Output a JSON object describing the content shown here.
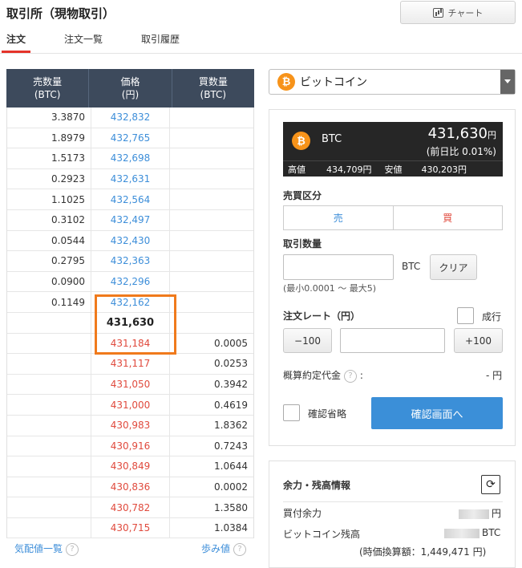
{
  "page_title": "取引所（現物取引）",
  "chart_button": {
    "label": "チャート",
    "icon": "chart-icon"
  },
  "tabs": [
    {
      "label": "注文",
      "active": true
    },
    {
      "label": "注文一覧",
      "active": false
    },
    {
      "label": "取引履歴",
      "active": false
    }
  ],
  "order_book": {
    "headers": [
      "売数量\n(BTC)",
      "価格\n(円)",
      "買数量\n(BTC)"
    ],
    "asks": [
      {
        "qty": "3.3870",
        "price": "432,832"
      },
      {
        "qty": "1.8979",
        "price": "432,765"
      },
      {
        "qty": "1.5173",
        "price": "432,698"
      },
      {
        "qty": "0.2923",
        "price": "432,631"
      },
      {
        "qty": "1.1025",
        "price": "432,564"
      },
      {
        "qty": "0.3102",
        "price": "432,497"
      },
      {
        "qty": "0.0544",
        "price": "432,430"
      },
      {
        "qty": "0.2795",
        "price": "432,363"
      },
      {
        "qty": "0.0900",
        "price": "432,296"
      },
      {
        "qty": "0.1149",
        "price": "432,162"
      }
    ],
    "mid_price": "431,630",
    "bids": [
      {
        "price": "431,184",
        "qty": "0.0005"
      },
      {
        "price": "431,117",
        "qty": "0.0253"
      },
      {
        "price": "431,050",
        "qty": "0.3942"
      },
      {
        "price": "431,000",
        "qty": "0.4619"
      },
      {
        "price": "430,983",
        "qty": "1.8362"
      },
      {
        "price": "430,916",
        "qty": "0.7243"
      },
      {
        "price": "430,849",
        "qty": "1.0644"
      },
      {
        "price": "430,836",
        "qty": "0.0002"
      },
      {
        "price": "430,782",
        "qty": "1.3580"
      },
      {
        "price": "430,715",
        "qty": "1.0384"
      }
    ],
    "footer_left": "気配値一覧",
    "footer_right": "歩み値"
  },
  "coin_select": {
    "value": "ビットコイン",
    "icon": "bitcoin-icon"
  },
  "ticker": {
    "symbol": "BTC",
    "price": "431,630",
    "price_unit": "円",
    "change": "(前日比 0.01%)",
    "high_label": "高値",
    "high": "434,709円",
    "low_label": "安値",
    "low": "430,203円"
  },
  "order_form": {
    "side_label": "売買区分",
    "sell_label": "売",
    "buy_label": "買",
    "qty_label": "取引数量",
    "qty_unit": "BTC",
    "clear_label": "クリア",
    "qty_hint": "(最小0.0001 ～ 最大5)",
    "rate_label": "注文レート（円）",
    "market_label": "成行",
    "minus_label": "−100",
    "plus_label": "+100",
    "estimate_label": "概算約定代金",
    "estimate_value": "- 円",
    "skip_confirm_label": "確認省略",
    "confirm_button": "確認画面へ"
  },
  "balance": {
    "title": "余力・残高情報",
    "buying_power_label": "買付余力",
    "buying_power_unit": "円",
    "btc_balance_label": "ビットコイン残高",
    "btc_unit": "BTC",
    "valuation": "(時価換算額：1,449,471 円)"
  },
  "colors": {
    "ask_price": "#3d8ed9",
    "bid_price": "#e04a3d",
    "header_bg": "#3d4a5c",
    "accent_orange": "#f07a1c",
    "confirm_bg": "#3b8fd8",
    "btc_orange": "#f7931a"
  }
}
